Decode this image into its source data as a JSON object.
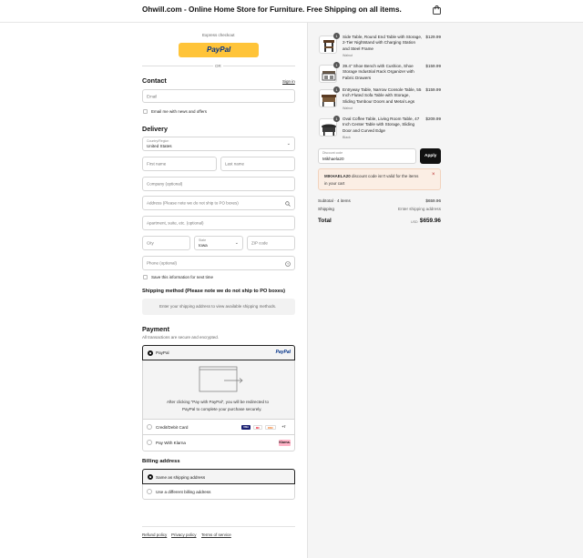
{
  "header": {
    "title": "Ohwill.com - Online Home Store for Furniture. Free Shipping on all items.",
    "cart_icon": "shopping-bag-icon"
  },
  "express": {
    "label": "Express checkout",
    "paypal_label": "PayPal",
    "or_label": "OR"
  },
  "contact": {
    "heading": "Contact",
    "sign_in": "Sign in",
    "email_placeholder": "Email",
    "news_label": "Email me with news and offers"
  },
  "delivery": {
    "heading": "Delivery",
    "country_label": "Country/Region",
    "country_value": "United States",
    "first_name": "First name",
    "last_name": "Last name",
    "company": "Company (optional)",
    "address": "Address (Please note we do not ship to PO boxes)",
    "apartment": "Apartment, suite, etc. (optional)",
    "city": "City",
    "state_label": "State",
    "state_value": "Iowa",
    "zip": "ZIP code",
    "phone": "Phone (optional)",
    "save_label": "Save this information for next time"
  },
  "shipping": {
    "heading": "Shipping method (Please note we do not ship to PO boxes)",
    "notice": "Enter your shipping address to view available shipping methods."
  },
  "payment": {
    "heading": "Payment",
    "subtitle": "All transactions are secure and encrypted.",
    "paypal_label": "PayPal",
    "paypal_logo": "PayPal",
    "redirect_text_1": "After clicking “Pay with PayPal”, you will be redirected to",
    "redirect_text_2": "PayPal to complete your purchase securely.",
    "card_label": "Credit/Debit Card",
    "card_brands": [
      "VISA",
      "MC",
      "DISC",
      "+7"
    ],
    "klarna_label": "Pay With Klarna",
    "klarna_logo": "Klarna."
  },
  "billing": {
    "heading": "Billing address",
    "same_label": "Same as shipping address",
    "different_label": "Use a different billing address"
  },
  "footer": {
    "links": [
      "Refund policy",
      "Privacy policy",
      "Terms of service"
    ]
  },
  "cart": {
    "items": [
      {
        "qty": "1",
        "name": "Side Table, Round End Table with Storage, 2-Tier Nightstand with Charging Station and Steel Frame",
        "variant": "Walnut",
        "price": "$129.99"
      },
      {
        "qty": "1",
        "name": "39.4\" Shoe Bench with Cushion, Shoe Storage Industrial Rack Organizer with Fabric Drawers",
        "variant": "",
        "price": "$159.99"
      },
      {
        "qty": "1",
        "name": "Entryway Table, Narrow Console Table, 55 Inch Fluted Sofa Table with Storage, Sliding Tambour Doors and Metal Legs",
        "variant": "Walnut",
        "price": "$159.99"
      },
      {
        "qty": "1",
        "name": "Oval Coffee Table, Living Room Table, 47 Inch Center Table with Storage, Sliding Door and Curved Edge",
        "variant": "Black",
        "price": "$209.99"
      }
    ],
    "discount_label": "Discount code",
    "discount_value": "Mikhaela20",
    "apply_label": "Apply",
    "error_code": "MIKHAELA20",
    "error_text_1": " discount code isn't valid for the items",
    "error_text_2": "in your cart",
    "subtotal_label": "Subtotal · 4 items",
    "subtotal_value": "$659.96",
    "shipping_label": "Shipping",
    "shipping_value": "Enter shipping address",
    "total_label": "Total",
    "currency": "USD",
    "total_value": "$659.96"
  }
}
